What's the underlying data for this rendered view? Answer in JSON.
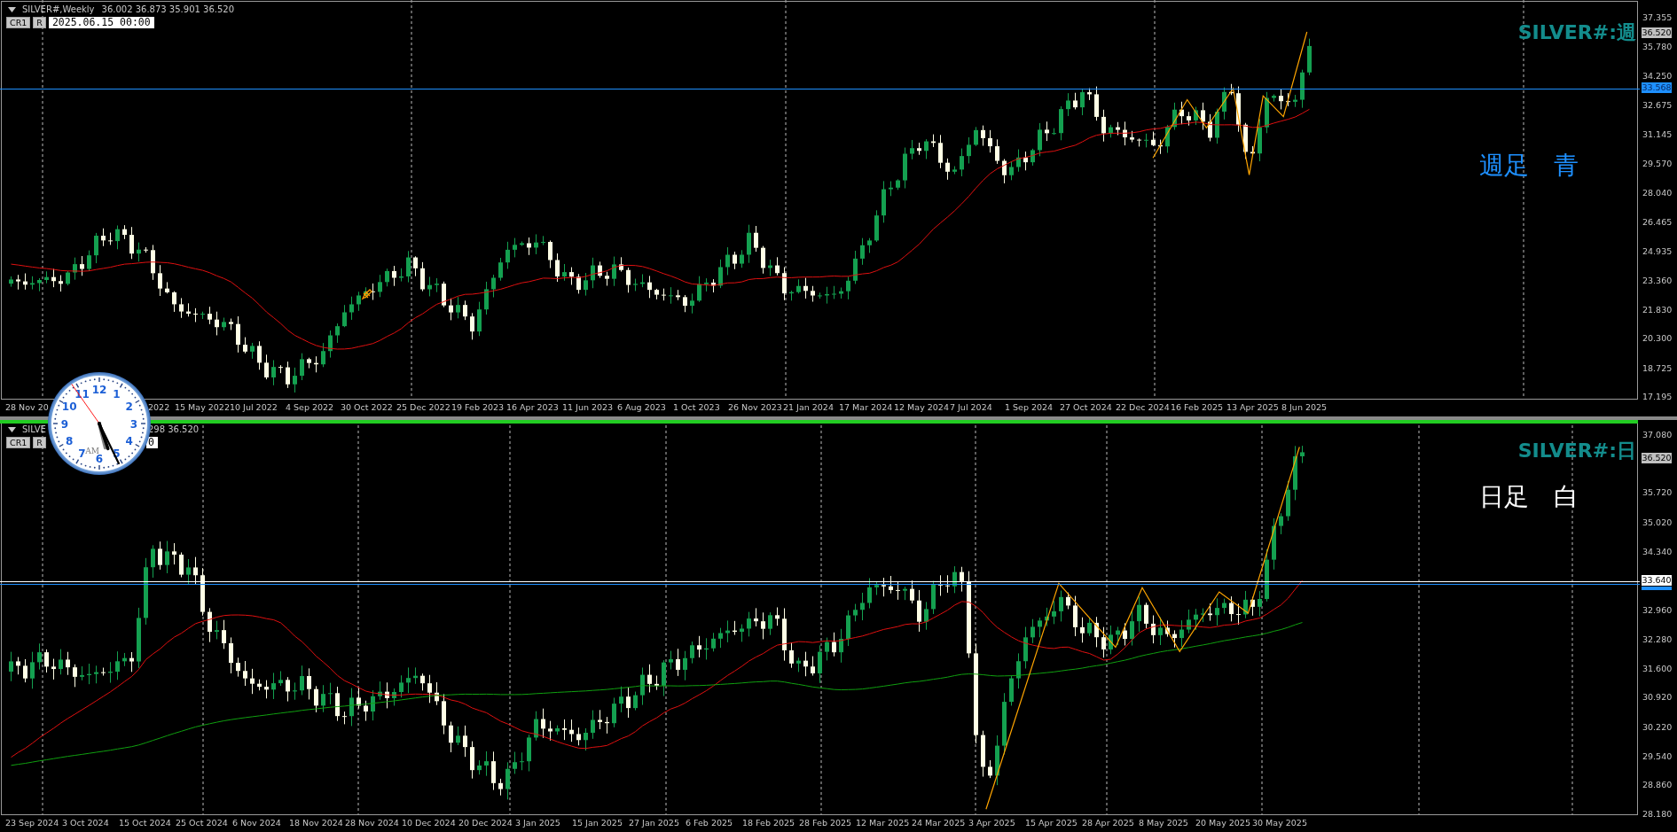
{
  "charts": [
    {
      "symbol": "SILVER#,Weekly",
      "ohlc": "36.002 36.873 35.901 36.520",
      "buttons": [
        "CR1",
        "R"
      ],
      "date_field": {
        "value": "2025.06.15 00:00"
      },
      "active": false,
      "title_label": "SILVER#:週",
      "note": {
        "text": "週足　青",
        "color": "#1e90ff"
      },
      "price_ticks": [
        "37.355",
        "35.780",
        "34.250",
        "32.675",
        "31.145",
        "29.570",
        "28.040",
        "26.465",
        "24.935",
        "23.360",
        "21.830",
        "20.300",
        "18.725",
        "17.195"
      ],
      "bid_label": "36.520",
      "price_lines": [
        {
          "kind": "blue",
          "label": "33.568"
        }
      ],
      "date_labels": [
        "28 Nov 20",
        "2022",
        "15 May 2022",
        "10 Jul 2022",
        "4 Sep 2022",
        "30 Oct 2022",
        "25 Dec 2022",
        "19 Feb 2023",
        "16 Apr 2023",
        "11 Jun 2023",
        "6 Aug 2023",
        "1 Oct 2023",
        "26 Nov 2023",
        "21 Jan 2024",
        "17 Mar 2024",
        "12 May 2024",
        "7 Jul 2024",
        "1 Sep 2024",
        "27 Oct 2024",
        "22 Dec 2024",
        "16 Feb 2025",
        "13 Apr 2025",
        "8 Jun 2025"
      ]
    },
    {
      "symbol": "SILVE",
      "ohlc": "298 36.520",
      "buttons": [
        "CR1",
        "R"
      ],
      "date_field": {
        "value": "0"
      },
      "active": true,
      "title_label": "SILVER#:日",
      "note": {
        "text": "日足　白",
        "color": "#ffffff"
      },
      "price_ticks": [
        "37.080",
        "35.720",
        "35.020",
        "34.340",
        "32.960",
        "32.280",
        "31.600",
        "30.920",
        "30.220",
        "29.540",
        "28.860",
        "28.180"
      ],
      "bid_label": "36.520",
      "price_lines": [
        {
          "kind": "white",
          "label": "33.640"
        },
        {
          "kind": "blue"
        }
      ],
      "date_labels": [
        "23 Sep 2024",
        "3 Oct 2024",
        "15 Oct 2024",
        "25 Oct 2024",
        "6 Nov 2024",
        "18 Nov 2024",
        "28 Nov 2024",
        "10 Dec 2024",
        "20 Dec 2024",
        "3 Jan 2025",
        "15 Jan 2025",
        "27 Jan 2025",
        "6 Feb 2025",
        "18 Feb 2025",
        "28 Feb 2025",
        "12 Mar 2025",
        "24 Mar 2025",
        "3 Apr 2025",
        "15 Apr 2025",
        "28 Apr 2025",
        "8 May 2025",
        "20 May 2025",
        "30 May 2025"
      ]
    }
  ],
  "clock": {
    "numerals": [
      "12",
      "11",
      "1",
      "10",
      "2",
      "9",
      "3",
      "8",
      "4",
      "7",
      "5",
      "6"
    ],
    "period": "AM"
  }
}
